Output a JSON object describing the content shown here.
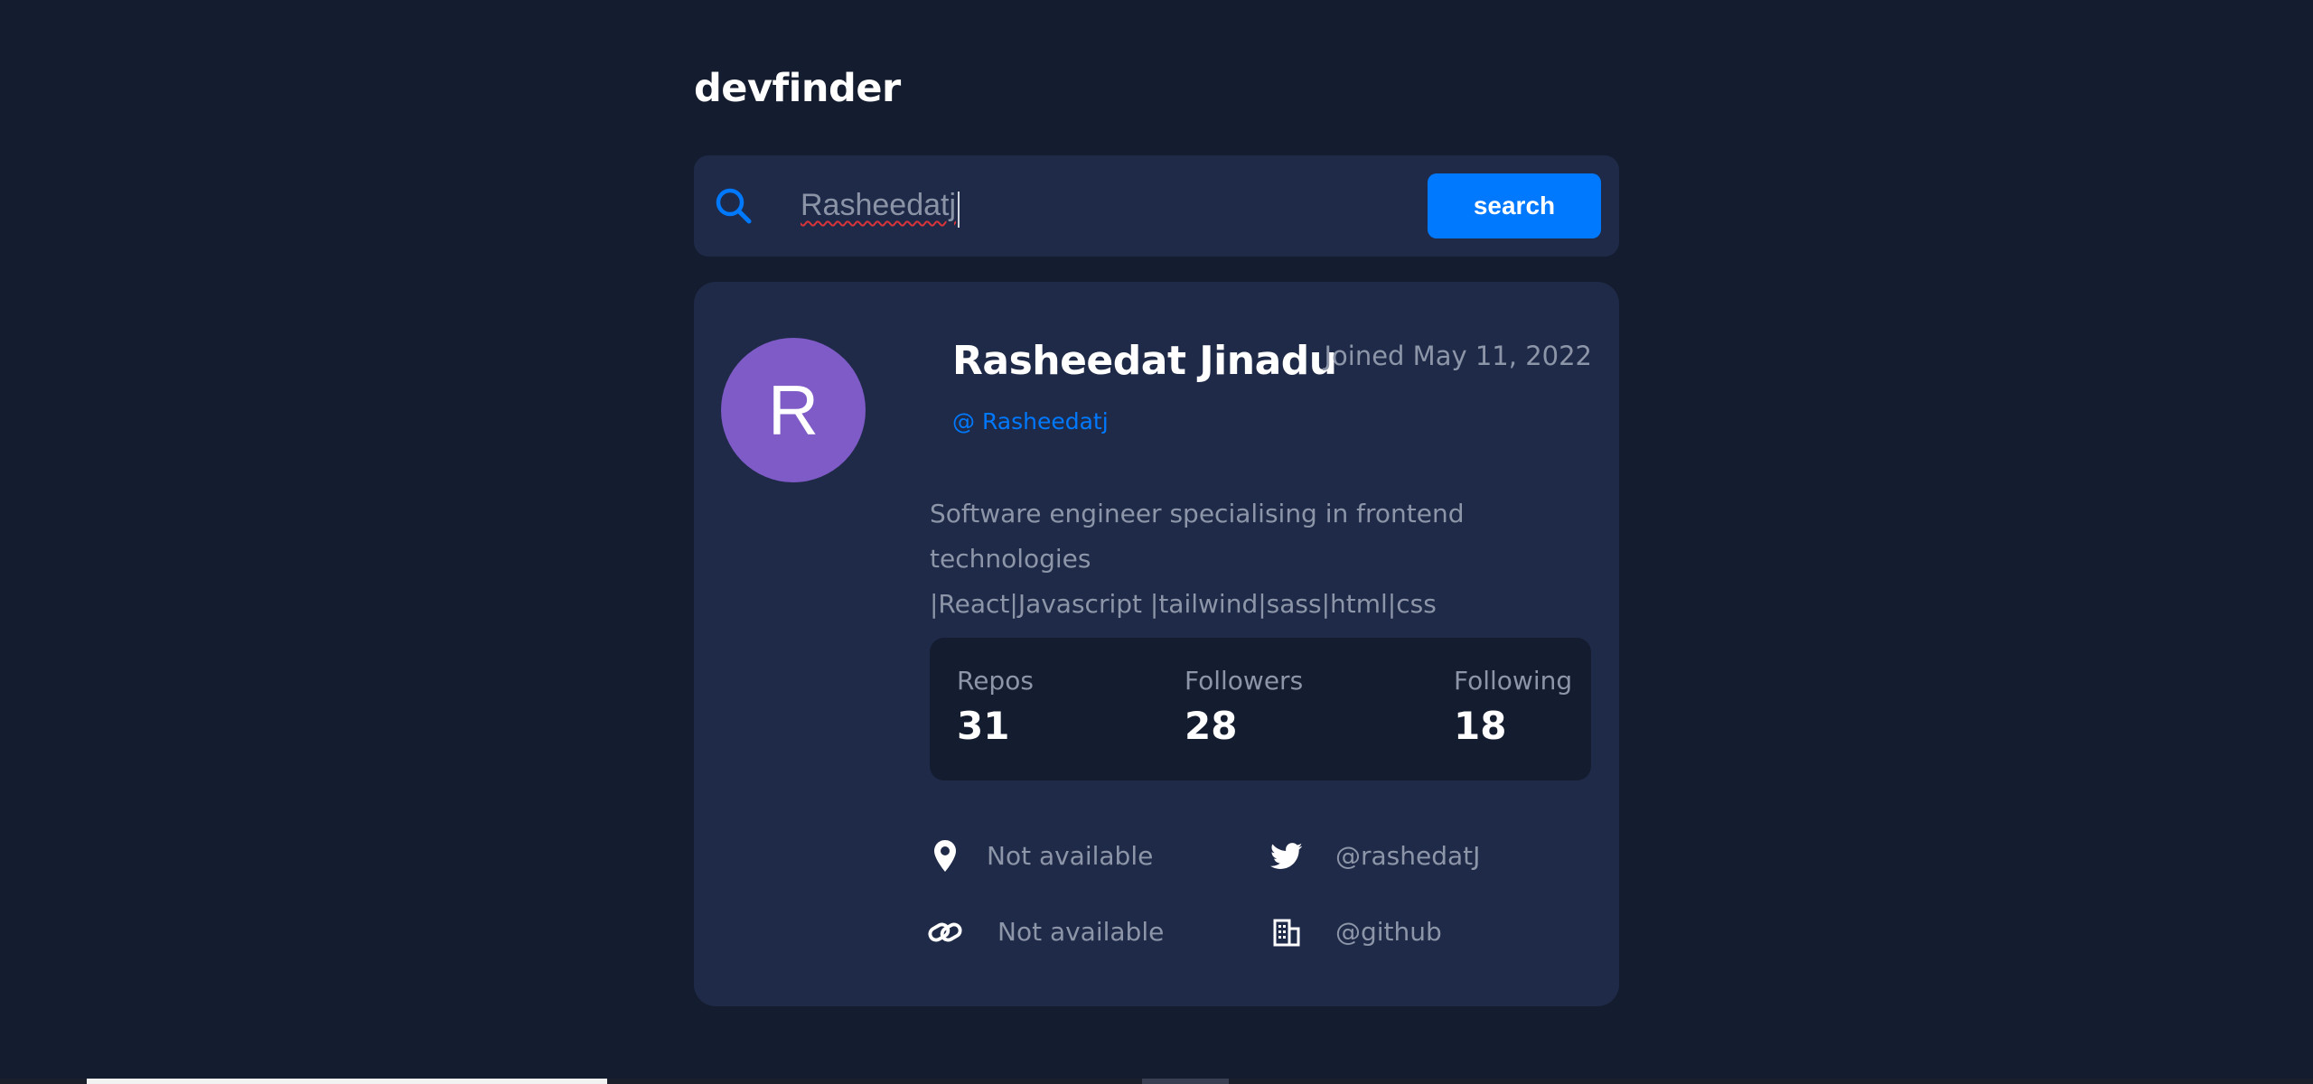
{
  "app": {
    "title": "devfinder"
  },
  "search": {
    "value": "Rasheedatj",
    "button_label": "search"
  },
  "profile": {
    "avatar_initial": "R",
    "name": "Rasheedat Jinadu",
    "joined": "Joined May 11, 2022",
    "handle": "@ Rasheedatj",
    "bio_line1": "Software engineer specialising in frontend technologies",
    "bio_line2": "|React|Javascript |tailwind|sass|html|css"
  },
  "stats": {
    "repos_label": "Repos",
    "repos_value": "31",
    "followers_label": "Followers",
    "followers_value": "28",
    "following_label": "Following",
    "following_value": "18"
  },
  "links": {
    "location": "Not available",
    "twitter": "@rashedatJ",
    "blog": "Not available",
    "company": "@github"
  },
  "icons": {
    "search": "search-icon",
    "location": "location-pin-icon",
    "twitter": "twitter-icon",
    "blog": "link-icon",
    "company": "building-icon"
  },
  "colors": {
    "background": "#141c2f",
    "card": "#1f2a48",
    "accent": "#0079ff",
    "avatar": "#7e5bc6",
    "muted_text": "#8d96a8",
    "white": "#ffffff"
  }
}
